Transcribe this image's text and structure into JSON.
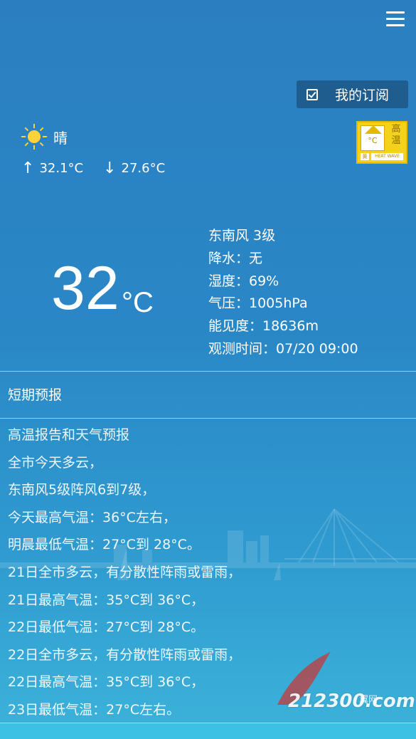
{
  "header": {
    "menu_icon": "hamburger-menu-icon"
  },
  "subscribe": {
    "label": "我的订阅",
    "icon": "checkbox-icon"
  },
  "alert_badge": {
    "chars": "高温",
    "level_text": "黄",
    "english": "HEAT WAVE",
    "color": "#f4d21b",
    "icon": "heat-warning-icon"
  },
  "current": {
    "condition": "晴",
    "condition_icon": "sun-icon",
    "high": "32.1°C",
    "low": "27.6°C",
    "temperature": "32",
    "unit": "°C"
  },
  "details": {
    "wind": "东南风 3级",
    "precip": "降水：无",
    "humidity": "湿度：69%",
    "pressure": "气压：1005hPa",
    "visibility": "能见度：18636m",
    "observed": "观测时间：07/20 09:00"
  },
  "short_forecast": {
    "title": "短期预报",
    "lines": [
      "高温报告和天气预报",
      "全市今天多云，",
      "东南风5级阵风6到7级，",
      "今天最高气温：36°C左右，",
      "明晨最低气温：27°C到 28°C。",
      "21日全市多云，有分散性阵雨或雷雨，",
      "21日最高气温：35°C到 36°C，",
      "22日最低气温：27°C到 28°C。",
      "22日全市多云，有分散性阵雨或雷雨，",
      "22日最高气温：35°C到 36°C，",
      "23日最低气温：27°C左右。"
    ]
  },
  "watermark": {
    "text": "212300.com",
    "label": "翼网"
  },
  "colors": {
    "bg_top": "#2b7fc1",
    "bg_bottom": "#3cb3da",
    "subscribe_bg": "#1f5d8f"
  }
}
